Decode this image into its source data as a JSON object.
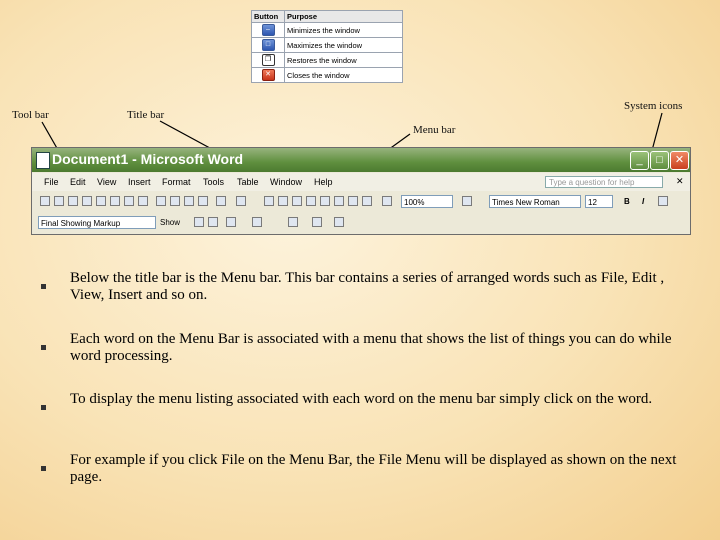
{
  "table": {
    "header": [
      "Button",
      "Purpose"
    ],
    "rows": [
      {
        "icon": "minimize-icon",
        "purpose": "Minimizes the window"
      },
      {
        "icon": "maximize-icon",
        "purpose": "Maximizes the window"
      },
      {
        "icon": "restore-icon",
        "purpose": "Restores the window"
      },
      {
        "icon": "close-icon",
        "purpose": "Closes the window"
      }
    ]
  },
  "callouts": {
    "toolbar": "Tool bar",
    "titlebar": "Title bar",
    "menubar": "Menu bar",
    "system_icons": "System icons"
  },
  "window": {
    "title": "Document1 - Microsoft Word",
    "menu": [
      "File",
      "Edit",
      "View",
      "Insert",
      "Format",
      "Tools",
      "Table",
      "Window",
      "Help"
    ],
    "help_placeholder": "Type a question for help",
    "zoom": "100%",
    "font": "Times New Roman",
    "font_size": "12",
    "bold": "B",
    "italic": "I",
    "markup": "Final Showing Markup",
    "show": "Show"
  },
  "bullets": [
    "Below the title bar is the Menu bar. This bar contains a series of arranged words such as File, Edit , View, Insert and so on.",
    "Each word on the Menu Bar is associated with a menu that shows the list of things you can do while word processing.",
    "To display the menu listing associated with each word on the menu bar simply click on the word.",
    "For example if you click File on the Menu Bar, the File Menu will be displayed as shown on the next page."
  ]
}
